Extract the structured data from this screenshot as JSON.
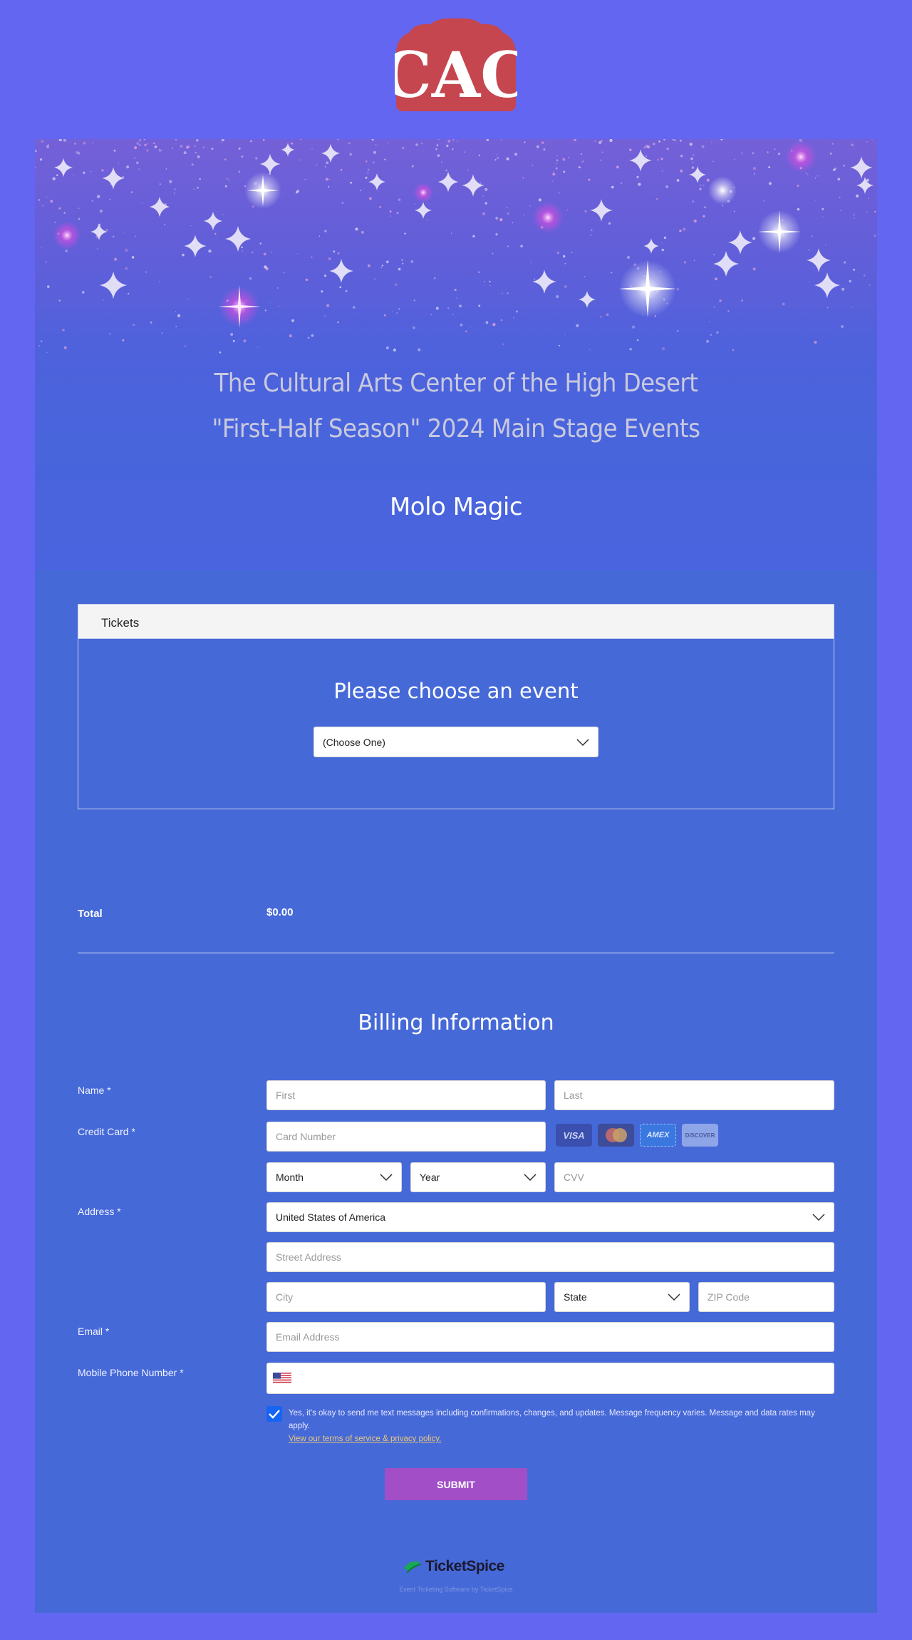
{
  "logo": {
    "text": "CAC",
    "color": "#c5464e"
  },
  "hero": {
    "line1": "The Cultural Arts Center of the High Desert",
    "line2": "\"First-Half Season\" 2024 Main Stage Events",
    "event_name": "Molo Magic"
  },
  "tickets": {
    "header": "Tickets",
    "title": "Please choose an event",
    "event_select": "(Choose One)"
  },
  "total": {
    "label": "Total",
    "value": "$0.00"
  },
  "billing": {
    "title": "Billing Information",
    "name_label": "Name",
    "first_placeholder": "First",
    "last_placeholder": "Last",
    "credit_card_label": "Credit Card",
    "card_number_placeholder": "Card Number",
    "card_brands": [
      "VISA",
      "Mastercard",
      "AMEX",
      "DISCOVER"
    ],
    "month_select": "Month",
    "year_select": "Year",
    "cvv_placeholder": "CVV",
    "address_label": "Address",
    "country_select": "United States of America",
    "street_placeholder": "Street Address",
    "city_placeholder": "City",
    "state_select": "State",
    "zip_placeholder": "ZIP Code",
    "email_label": "Email",
    "email_placeholder": "Email Address",
    "phone_label": "Mobile Phone Number",
    "required_mark": "*",
    "consent_text": "Yes, it's okay to send me text messages including confirmations, changes, and updates. Message frequency varies. Message and data rates may apply.",
    "consent_link": "View our terms of service & privacy policy.",
    "consent_checked": true,
    "submit_label": "SUBMIT"
  },
  "footer": {
    "brand": "TicketSpice",
    "tagline": "Event Ticketing Software by TicketSpice"
  },
  "colors": {
    "page_bg": "#6366f1",
    "card_bg": "#4669d8",
    "submit": "#a24fc7",
    "checkbox": "#1565f2"
  }
}
